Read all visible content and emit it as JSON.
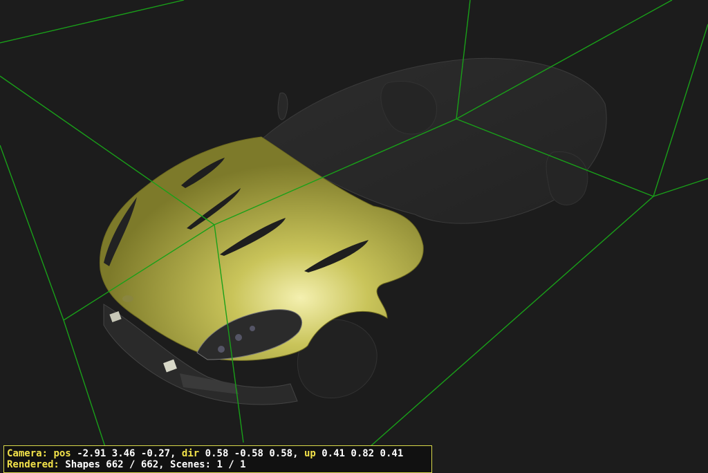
{
  "colors": {
    "background": "#1c1c1c",
    "bounding_box": "#19a019",
    "car_body": "#9e9a3a",
    "label_yellow": "#f2e24a",
    "value_white": "#ffffff",
    "status_border": "#d9d94a"
  },
  "viewer": {
    "camera": {
      "label": "Camera:",
      "pos_label": "pos",
      "pos_value": "-2.91 3.46 -0.27,",
      "dir_label": "dir",
      "dir_value": "0.58 -0.58 0.58,",
      "up_label": "up",
      "up_value": "0.41 0.82 0.41"
    },
    "rendered": {
      "label": "Rendered:",
      "value": "Shapes 662 / 662, Scenes: 1 / 1"
    }
  }
}
